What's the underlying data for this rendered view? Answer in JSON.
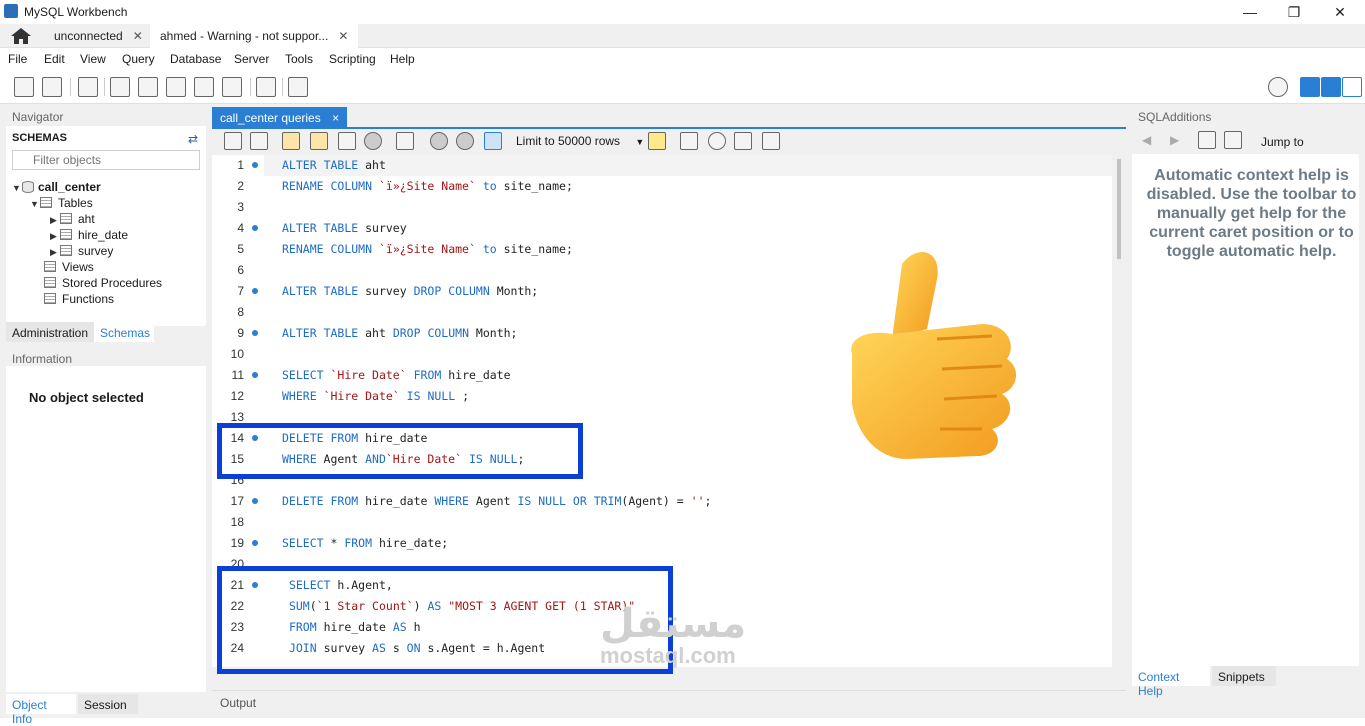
{
  "window": {
    "title": "MySQL Workbench",
    "controls": [
      "—",
      "❐",
      "✕"
    ]
  },
  "conn_tabs": [
    {
      "label": "unconnected"
    },
    {
      "label": "ahmed - Warning - not suppor..."
    }
  ],
  "menu": [
    "File",
    "Edit",
    "View",
    "Query",
    "Database",
    "Server",
    "Tools",
    "Scripting",
    "Help"
  ],
  "navigator": {
    "header": "Navigator",
    "schemas_label": "SCHEMAS",
    "filter_placeholder": "Filter objects",
    "schema": "call_center",
    "tables_label": "Tables",
    "tables": [
      "aht",
      "hire_date",
      "survey"
    ],
    "views_label": "Views",
    "procs_label": "Stored Procedures",
    "funcs_label": "Functions",
    "tab_admin": "Administration",
    "tab_schemas": "Schemas"
  },
  "information": {
    "header": "Information",
    "text": "No object selected",
    "tab_object": "Object Info",
    "tab_session": "Session"
  },
  "query_tab": {
    "label": "call_center queries",
    "close": "×"
  },
  "limit_select": "Limit to 50000 rows",
  "editor_lines": [
    {
      "n": "1",
      "dot": true,
      "code": "ALTER TABLE aht"
    },
    {
      "n": "2",
      "dot": false,
      "code": "RENAME COLUMN `ï»¿Site Name` to site_name;"
    },
    {
      "n": "3",
      "dot": false,
      "code": ""
    },
    {
      "n": "4",
      "dot": true,
      "code": "ALTER TABLE survey"
    },
    {
      "n": "5",
      "dot": false,
      "code": "RENAME COLUMN `ï»¿Site Name` to site_name;"
    },
    {
      "n": "6",
      "dot": false,
      "code": ""
    },
    {
      "n": "7",
      "dot": true,
      "code": "ALTER TABLE survey DROP COLUMN Month;"
    },
    {
      "n": "8",
      "dot": false,
      "code": ""
    },
    {
      "n": "9",
      "dot": true,
      "code": "ALTER TABLE aht DROP COLUMN Month;"
    },
    {
      "n": "10",
      "dot": false,
      "code": ""
    },
    {
      "n": "11",
      "dot": true,
      "code": "SELECT `Hire Date` FROM hire_date"
    },
    {
      "n": "12",
      "dot": false,
      "code": "WHERE `Hire Date` IS NULL ;"
    },
    {
      "n": "13",
      "dot": false,
      "code": ""
    },
    {
      "n": "14",
      "dot": true,
      "code": "DELETE FROM hire_date"
    },
    {
      "n": "15",
      "dot": false,
      "code": "WHERE Agent AND`Hire Date` IS NULL;"
    },
    {
      "n": "16",
      "dot": false,
      "code": ""
    },
    {
      "n": "17",
      "dot": true,
      "code": "DELETE FROM hire_date WHERE Agent IS NULL OR TRIM(Agent) = '';"
    },
    {
      "n": "18",
      "dot": false,
      "code": ""
    },
    {
      "n": "19",
      "dot": true,
      "code": "SELECT * FROM hire_date;"
    },
    {
      "n": "20",
      "dot": false,
      "code": ""
    },
    {
      "n": "21",
      "dot": true,
      "code": " SELECT h.Agent,"
    },
    {
      "n": "22",
      "dot": false,
      "code": " SUM(`1 Star Count`) AS \"MOST 3 AGENT GET (1 STAR)\""
    },
    {
      "n": "23",
      "dot": false,
      "code": " FROM hire_date AS h"
    },
    {
      "n": "24",
      "dot": false,
      "code": " JOIN survey AS s ON s.Agent = h.Agent"
    }
  ],
  "output_label": "Output",
  "sql_additions": {
    "header": "SQLAdditions",
    "jump_to": "Jump to",
    "help_text": "Automatic context help is disabled. Use the toolbar to manually get help for the current caret position or to toggle automatic help.",
    "tab_context": "Context Help",
    "tab_snippets": "Snippets"
  },
  "watermark": {
    "arabic": "مستقل",
    "latin": "mostaql.com"
  },
  "colors": {
    "accent": "#2a7fd4",
    "highlight_box": "#0b3fd6",
    "keyword": "#1e6cc4",
    "string": "#a31515"
  }
}
